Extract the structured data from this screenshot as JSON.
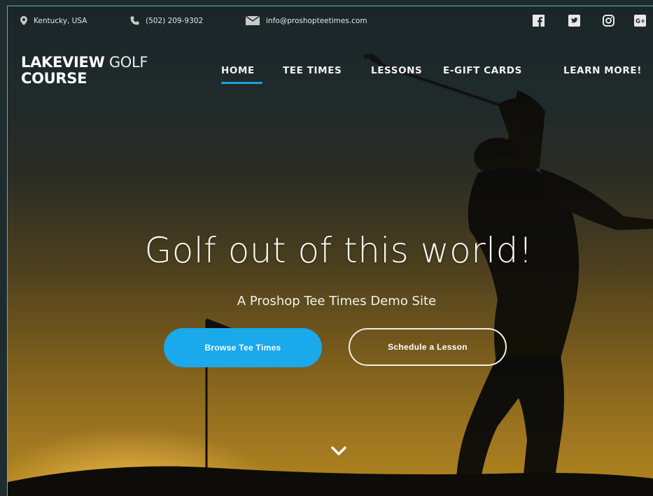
{
  "topbar": {
    "location": "Kentucky, USA",
    "phone": "(502) 209-9302",
    "email": "info@proshopteetimes.com"
  },
  "logo": {
    "bold": "LAKEVIEW",
    "light": "GOLF",
    "line2": "COURSE"
  },
  "nav": {
    "items": [
      {
        "label": "HOME"
      },
      {
        "label": "TEE TIMES"
      },
      {
        "label": "LESSONS"
      },
      {
        "label": "E-GIFT CARDS"
      },
      {
        "label": "LEARN MORE!"
      }
    ]
  },
  "hero": {
    "title": "Golf out of this world!",
    "subtitle": "A Proshop Tee Times Demo Site",
    "primary_button": "Browse Tee Times",
    "secondary_button": "Schedule a Lesson"
  },
  "colors": {
    "accent": "#1aa9ea",
    "frame_border": "#55b3b8"
  },
  "icons": [
    "map-pin-icon",
    "phone-icon",
    "mail-icon",
    "facebook-icon",
    "twitter-icon",
    "instagram-icon",
    "google-plus-icon",
    "chevron-down-icon"
  ]
}
